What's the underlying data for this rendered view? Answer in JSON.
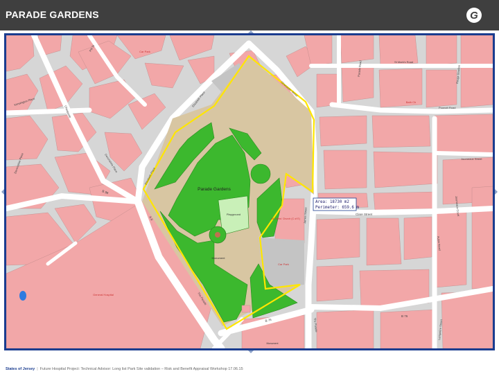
{
  "header": {
    "title": "PARADE GARDENS",
    "logo_letter": "G"
  },
  "map": {
    "park_label": "Parade Gardens",
    "playground_label": "Playground",
    "monument_label": "Monument",
    "car_park_label": "Car Park",
    "hospital_label": "General Hospital",
    "church_label": "All Saints' Church (C of E)",
    "bath_label": "Bath Ch",
    "area_label": "Area: 18730 m2",
    "perimeter_label": "Perimeter: 659.6 m",
    "streets": {
      "elizabeth_place": "Elizabeth Place",
      "gloucester_street": "Gloucester Street",
      "the_parade": "The Parade",
      "parade_road": "Parade Road",
      "b76": "B 76",
      "b98": "B 98",
      "a9": "A 9",
      "clare_street": "Clare Street",
      "rouge_bouillon": "Rouge Bouillon",
      "journeaux_street": "Journeaux Street",
      "journeaux_court": "Journeaux Court",
      "poonah_road": "Poonah Road",
      "st_marks_road": "St Mark's Road",
      "cheapside": "Cheapside",
      "aubin_road": "Aubin Road",
      "lemprierre": "Lemprière Street",
      "pitt_street": "Pitt St",
      "kensington": "Kensington Place",
      "devonshire": "Devonshire Place",
      "james_street": "James Street",
      "elizabeth_place2": "Elizabeth Place"
    }
  },
  "footer": {
    "org": "States of Jersey",
    "text": "Future Hospital Project: Technical Advisor: Long list Park Site validation – Risk and Benefit Appraisal Workshop 17.06.15"
  },
  "colors": {
    "header_bg": "#3f3f3f",
    "frame": "#1a3c8f",
    "building": "#f2a7a8",
    "road": "#ffffff",
    "background": "#d9d9d9",
    "grass": "#3cb82e",
    "path": "#d8c6a2",
    "boundary": "#ffe600"
  }
}
